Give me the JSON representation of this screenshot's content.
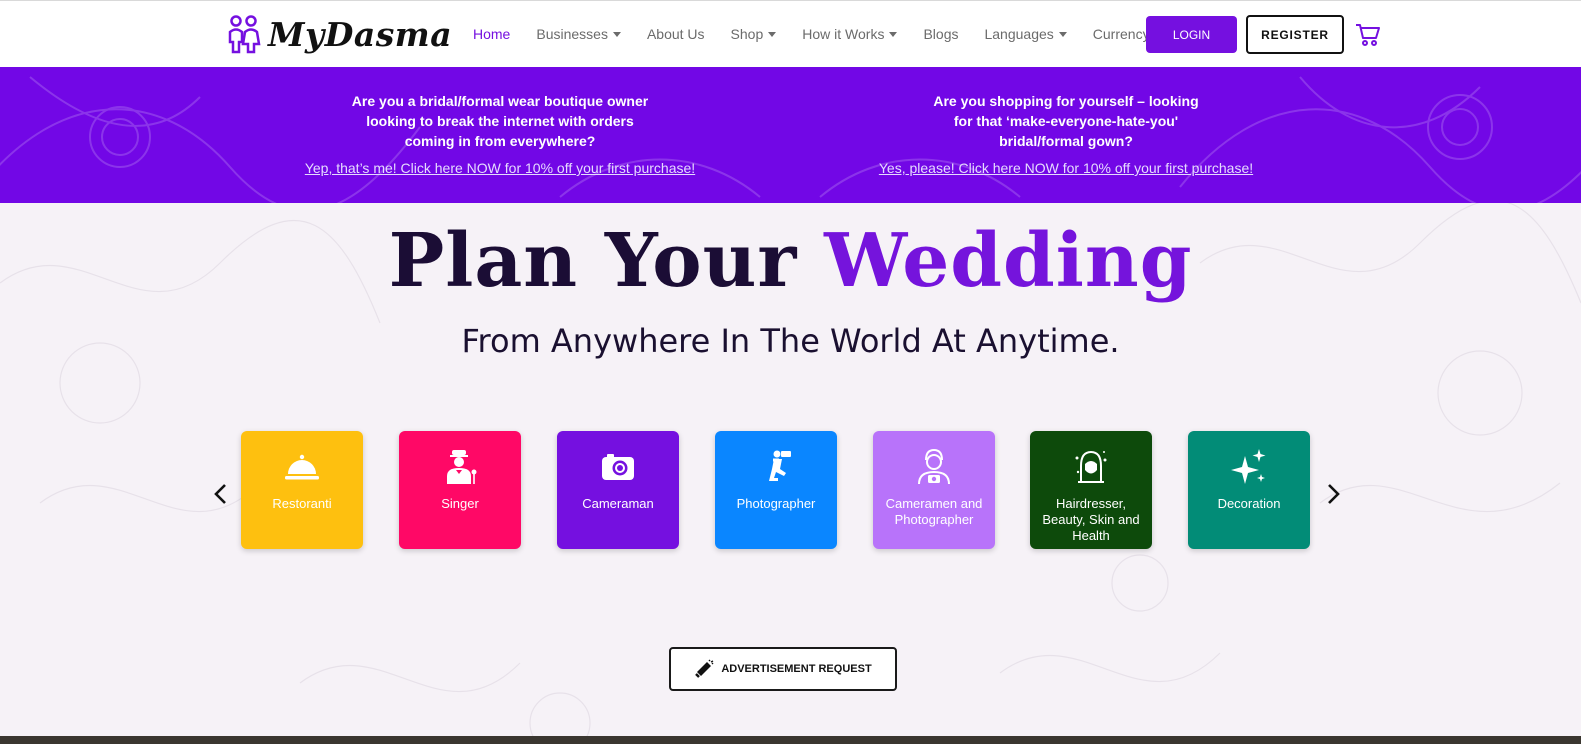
{
  "brand": {
    "name": "MyDasma",
    "accent": "#7510e0"
  },
  "nav": {
    "items": [
      {
        "label": "Home",
        "active": true,
        "dropdown": false
      },
      {
        "label": "Businesses",
        "active": false,
        "dropdown": true
      },
      {
        "label": "About Us",
        "active": false,
        "dropdown": false
      },
      {
        "label": "Shop",
        "active": false,
        "dropdown": true
      },
      {
        "label": "How it Works",
        "active": false,
        "dropdown": true
      },
      {
        "label": "Blogs",
        "active": false,
        "dropdown": false
      },
      {
        "label": "Languages",
        "active": false,
        "dropdown": true
      },
      {
        "label": "Currency",
        "active": false,
        "dropdown": true
      }
    ],
    "login_label": "LOGIN",
    "register_label": "REGISTER",
    "cart_icon": "cart-icon"
  },
  "promo": {
    "left": {
      "lines": [
        "Are you a bridal/formal wear boutique owner",
        "looking to break the internet with orders",
        "coming in from everywhere?"
      ],
      "link": "Yep, that’s me! Click here NOW for 10% off your first purchase!"
    },
    "right": {
      "lines": [
        "Are you shopping for yourself – looking",
        "for that ‘make-everyone-hate-you'",
        "bridal/formal gown?"
      ],
      "link": "Yes, please! Click here NOW for 10% off your first purchase!"
    }
  },
  "hero": {
    "title_main": "Plan Your ",
    "title_accent": "Wedding",
    "subtitle": "From Anywhere In The World At Anytime."
  },
  "categories": [
    {
      "label": "Restoranti",
      "color": "#fec00f",
      "icon": "cloche-icon"
    },
    {
      "label": "Singer",
      "color": "#ff0866",
      "icon": "singer-icon"
    },
    {
      "label": "Cameraman",
      "color": "#7510e0",
      "icon": "camera-icon"
    },
    {
      "label": "Photographer",
      "color": "#0a86ff",
      "icon": "photographer-icon"
    },
    {
      "label": "Cameramen and Photographer",
      "color": "#b873fa",
      "icon": "camera-person-icon"
    },
    {
      "label": "Hairdresser, Beauty, Skin and Health",
      "color": "#0d4a0b",
      "icon": "hairdresser-icon"
    },
    {
      "label": "Decoration",
      "color": "#028c77",
      "icon": "sparkles-icon"
    }
  ],
  "advertisement_label": "ADVERTISEMENT REQUEST"
}
